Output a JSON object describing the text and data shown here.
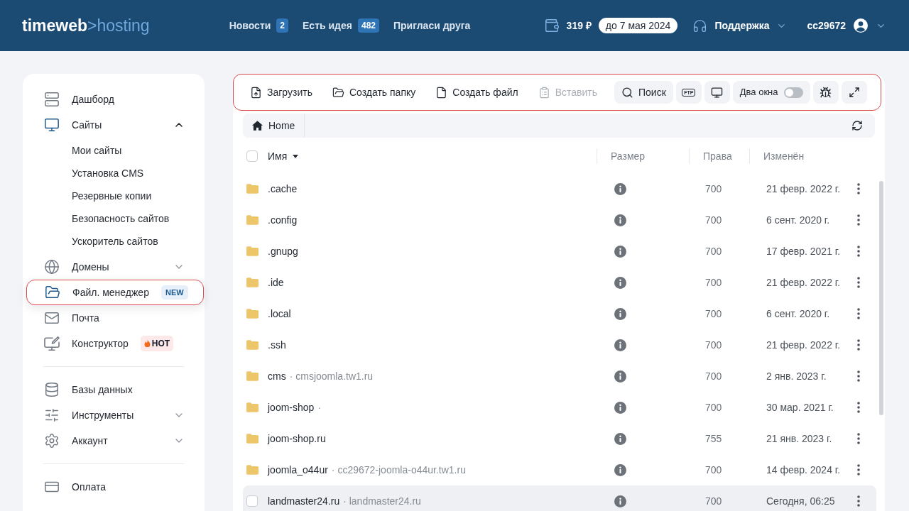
{
  "header": {
    "logo": {
      "brand": "timeweb",
      "separator": ">",
      "product": "hosting"
    },
    "nav": [
      {
        "label": "Новости",
        "count": "2"
      },
      {
        "label": "Есть идея",
        "count": "482"
      },
      {
        "label": "Пригласи друга"
      }
    ],
    "balance": "319 ₽",
    "paid_until": "до 7 мая 2024",
    "support": "Поддержка",
    "user": "cc29672"
  },
  "sidebar": {
    "sections": [
      {
        "items": [
          {
            "label": "Дашборд",
            "kind": "link",
            "selected": false
          },
          {
            "label": "Сайты",
            "kind": "group",
            "expanded": true,
            "selected": false,
            "children": [
              {
                "label": "Мои сайты"
              },
              {
                "label": "Установка CMS"
              },
              {
                "label": "Резервные копии"
              },
              {
                "label": "Безопасность сайтов"
              },
              {
                "label": "Ускоритель сайтов"
              }
            ]
          },
          {
            "label": "Домены",
            "kind": "group",
            "expanded": false,
            "selected": false
          },
          {
            "label": "Файл. менеджер",
            "kind": "link",
            "selected": true,
            "badge": {
              "text": "NEW",
              "kind": "new"
            }
          },
          {
            "label": "Почта",
            "kind": "link",
            "selected": false
          },
          {
            "label": "Конструктор",
            "kind": "link",
            "selected": false,
            "badge": {
              "text": "HOT",
              "kind": "hot"
            }
          }
        ]
      },
      {
        "items": [
          {
            "label": "Базы данных",
            "kind": "link",
            "selected": false
          },
          {
            "label": "Инструменты",
            "kind": "group",
            "expanded": false,
            "selected": false
          },
          {
            "label": "Аккаунт",
            "kind": "group",
            "expanded": false,
            "selected": false
          }
        ]
      },
      {
        "items": [
          {
            "label": "Оплата",
            "kind": "link",
            "selected": false
          }
        ]
      }
    ]
  },
  "toolbar": {
    "actions": [
      {
        "label": "Загрузить",
        "disabled": false
      },
      {
        "label": "Создать папку",
        "disabled": false
      },
      {
        "label": "Создать файл",
        "disabled": false
      },
      {
        "label": "Вставить",
        "disabled": true
      }
    ],
    "search": "Поиск",
    "ftp": "FTP",
    "two_windows": {
      "label": "Два окна",
      "on": false
    }
  },
  "breadcrumb": [
    "Home"
  ],
  "table": {
    "select_all": {
      "checked": false
    },
    "columns": [
      {
        "label": "Имя",
        "sorted": true
      },
      {
        "label": "Размер",
        "sorted": false
      },
      {
        "label": "Права",
        "sorted": false
      },
      {
        "label": "Изменён",
        "sorted": false
      }
    ],
    "rows": [
      {
        "name": ".cache",
        "permissions": "700",
        "modified": "21 февр. 2022 г.",
        "hovered": false,
        "checked": false
      },
      {
        "name": ".config",
        "permissions": "700",
        "modified": "6 сент. 2020 г.",
        "hovered": false,
        "checked": false
      },
      {
        "name": ".gnupg",
        "permissions": "700",
        "modified": "17 февр. 2021 г.",
        "hovered": false,
        "checked": false
      },
      {
        "name": ".ide",
        "permissions": "700",
        "modified": "21 февр. 2022 г.",
        "hovered": false,
        "checked": false
      },
      {
        "name": ".local",
        "permissions": "700",
        "modified": "6 сент. 2020 г.",
        "hovered": false,
        "checked": false
      },
      {
        "name": ".ssh",
        "permissions": "700",
        "modified": "21 февр. 2022 г.",
        "hovered": false,
        "checked": false
      },
      {
        "name": "cms",
        "details": "· cmsjoomla.tw1.ru",
        "permissions": "700",
        "modified": "2 янв. 2023 г.",
        "hovered": false,
        "checked": false
      },
      {
        "name": "joom-shop",
        "details": "·",
        "permissions": "700",
        "modified": "30 мар. 2021 г.",
        "hovered": false,
        "checked": false
      },
      {
        "name": "joom-shop.ru",
        "permissions": "755",
        "modified": "21 янв. 2023 г.",
        "hovered": false,
        "checked": false
      },
      {
        "name": "joomla_o44ur",
        "details": "· cc29672-joomla-o44ur.tw1.ru",
        "permissions": "700",
        "modified": "14 февр. 2024 г.",
        "hovered": false,
        "checked": false
      },
      {
        "name": "landmaster24.ru",
        "details": "· landmaster24.ru",
        "permissions": "700",
        "modified": "Сегодня, 06:25",
        "hovered": true,
        "checked": false
      }
    ]
  }
}
